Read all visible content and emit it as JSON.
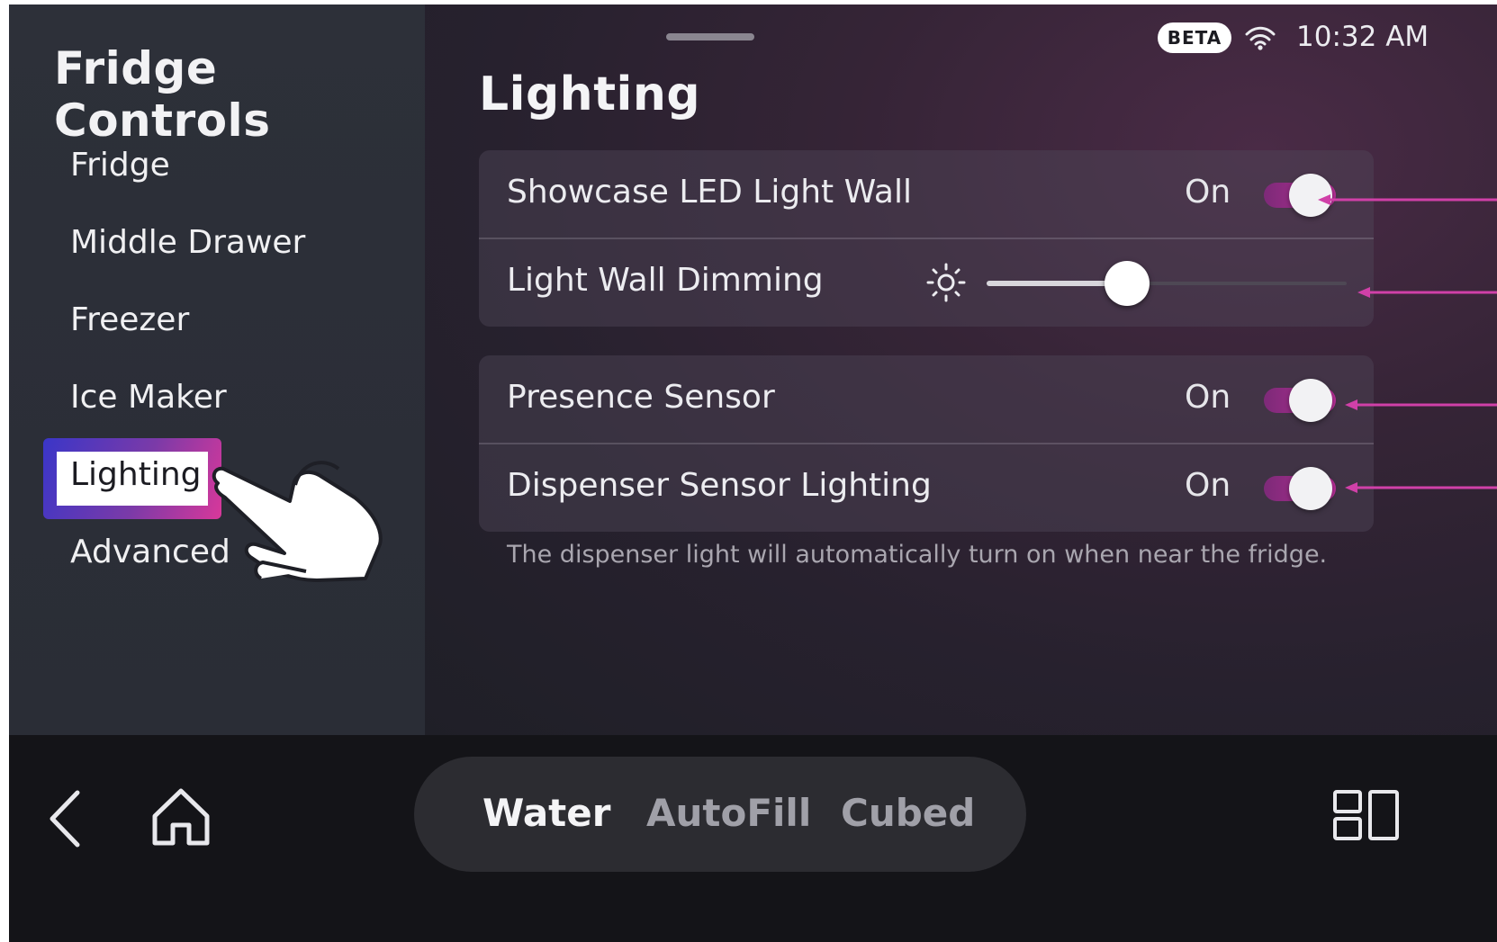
{
  "sidebar": {
    "title": "Fridge Controls",
    "items": [
      {
        "label": "Fridge"
      },
      {
        "label": "Middle Drawer"
      },
      {
        "label": "Freezer"
      },
      {
        "label": "Ice Maker"
      },
      {
        "label": "Lighting",
        "active": true
      },
      {
        "label": "Advanced"
      }
    ]
  },
  "status": {
    "badge": "BETA",
    "wifi_icon": "wifi-icon",
    "time": "10:32 AM"
  },
  "page": {
    "title": "Lighting",
    "settings": [
      {
        "label": "Showcase LED Light Wall",
        "state": "On",
        "type": "toggle",
        "on": true
      },
      {
        "label": "Light Wall Dimming",
        "type": "slider",
        "icon": "brightness-icon",
        "value_fraction": 0.39
      },
      {
        "label": "Presence Sensor",
        "state": "On",
        "type": "toggle",
        "on": true
      },
      {
        "label": "Dispenser Sensor Lighting",
        "state": "On",
        "type": "toggle",
        "on": true
      }
    ],
    "hint": "The dispenser light will automatically turn on when near the fridge."
  },
  "bottom_bar": {
    "back_icon": "chevron-left-icon",
    "home_icon": "home-icon",
    "dispenser_modes": [
      {
        "label": "Water",
        "selected": true
      },
      {
        "label": "AutoFill",
        "selected": false
      },
      {
        "label": "Cubed",
        "selected": false
      }
    ],
    "apps_icon": "apps-grid-icon"
  },
  "colors": {
    "accent": "#c2399f",
    "selected_frame_start": "#3a36c8",
    "selected_frame_end": "#d8389a",
    "toggle_on": "#b72f96",
    "callout_arrow": "#d040a8"
  }
}
